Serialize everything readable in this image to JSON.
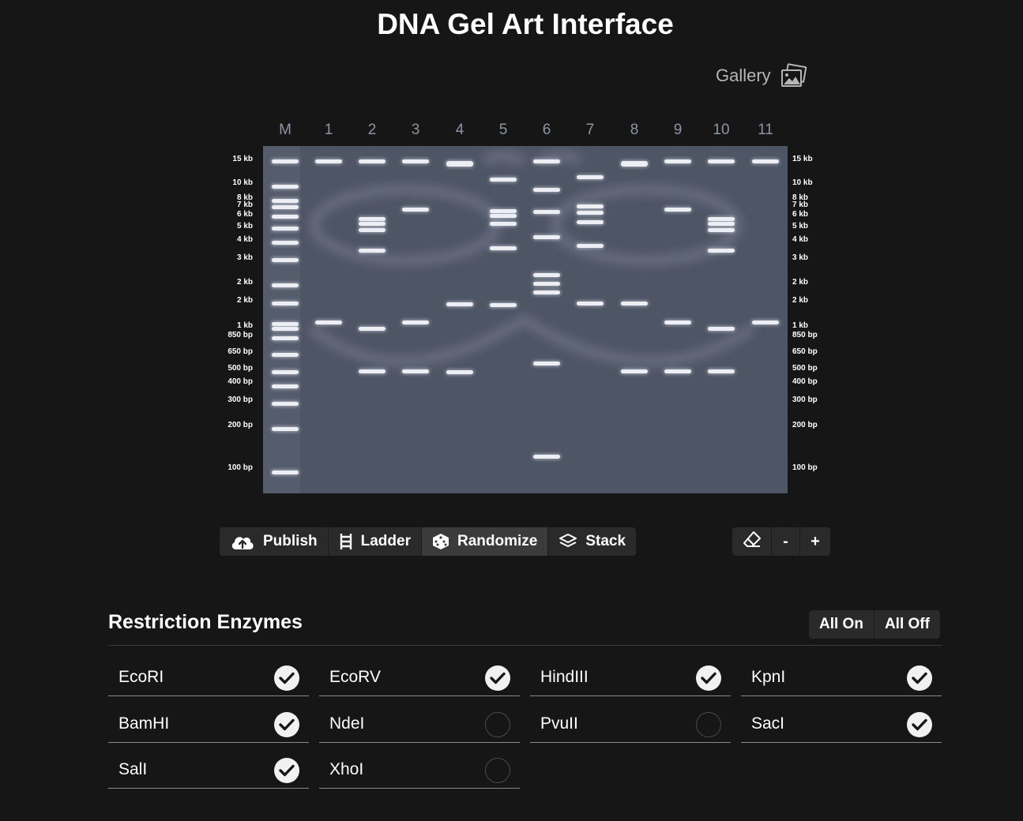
{
  "title": "DNA Gel Art Interface",
  "gallery": {
    "label": "Gallery",
    "icon": "gallery-icon"
  },
  "gel": {
    "lane_labels": [
      "M",
      "1",
      "2",
      "3",
      "4",
      "5",
      "6",
      "7",
      "8",
      "9",
      "10",
      "11"
    ],
    "ladder_sizes": [
      {
        "label": "15 kb"
      },
      {
        "label": "10 kb"
      },
      {
        "label": "8 kb"
      },
      {
        "label": "7 kb"
      },
      {
        "label": "6 kb"
      },
      {
        "label": "5 kb"
      },
      {
        "label": "4 kb"
      },
      {
        "label": "3 kb"
      },
      {
        "label": "2 kb"
      },
      {
        "label": "2 kb"
      },
      {
        "label": "1 kb"
      },
      {
        "label": "850 bp"
      },
      {
        "label": "650 bp"
      },
      {
        "label": "500 bp"
      },
      {
        "label": "400 bp"
      },
      {
        "label": "300 bp"
      },
      {
        "label": "200 bp"
      },
      {
        "label": "100 bp"
      }
    ]
  },
  "toolbar": {
    "publish_label": "Publish",
    "ladder_label": "Ladder",
    "randomize_label": "Randomize",
    "stack_label": "Stack",
    "eraser_icon": "eraser-icon",
    "zoom_out_label": "-",
    "zoom_in_label": "+"
  },
  "enzymes": {
    "title": "Restriction Enzymes",
    "all_on_label": "All On",
    "all_off_label": "All Off",
    "items": [
      {
        "name": "EcoRI",
        "checked": true
      },
      {
        "name": "EcoRV",
        "checked": true
      },
      {
        "name": "HindIII",
        "checked": true
      },
      {
        "name": "KpnI",
        "checked": true
      },
      {
        "name": "BamHI",
        "checked": true
      },
      {
        "name": "NdeI",
        "checked": false
      },
      {
        "name": "PvuII",
        "checked": false
      },
      {
        "name": "SacI",
        "checked": true
      },
      {
        "name": "SalI",
        "checked": true
      },
      {
        "name": "XhoI",
        "checked": false
      }
    ]
  },
  "colors": {
    "background": "#161616",
    "gel": "#4e5565",
    "band": "#eceef3",
    "lane_label": "#8d94a3"
  }
}
